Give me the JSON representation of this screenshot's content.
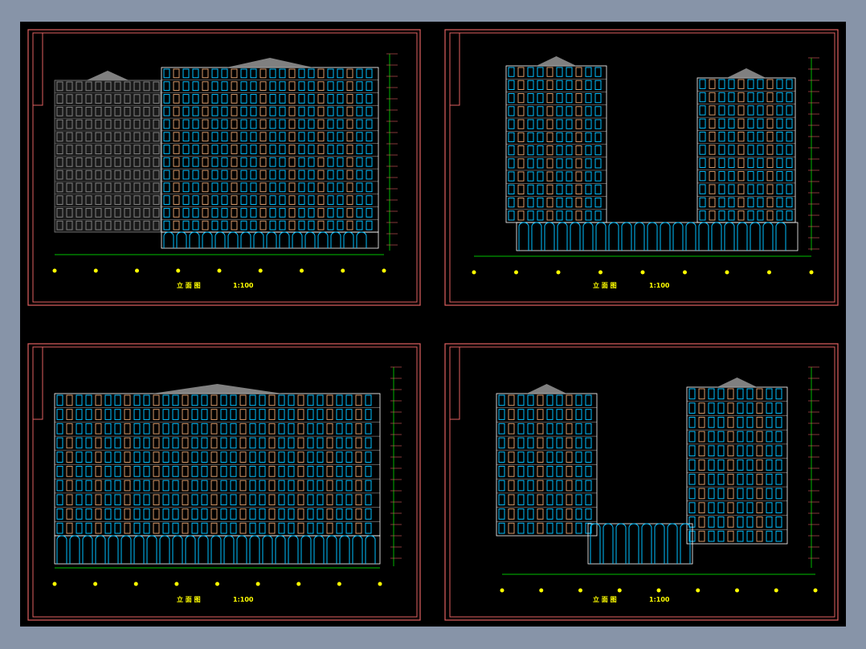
{
  "drawing": {
    "background_color": "#000000",
    "frame_color": "#e06060",
    "colors": {
      "window": "#00bfff",
      "wall": "#808080",
      "accent": "#d89a6a",
      "dimension": "#00ff00",
      "title": "#ffff00",
      "outline": "#ffffff"
    },
    "sheets": [
      {
        "id": "elevation-1",
        "title": "立 面 图",
        "scale": "1:100"
      },
      {
        "id": "elevation-2",
        "title": "立 面 图",
        "scale": "1:100"
      },
      {
        "id": "elevation-3",
        "title": "立 面 图",
        "scale": "1:100"
      },
      {
        "id": "elevation-4",
        "title": "立 面 图",
        "scale": "1:100"
      }
    ]
  }
}
